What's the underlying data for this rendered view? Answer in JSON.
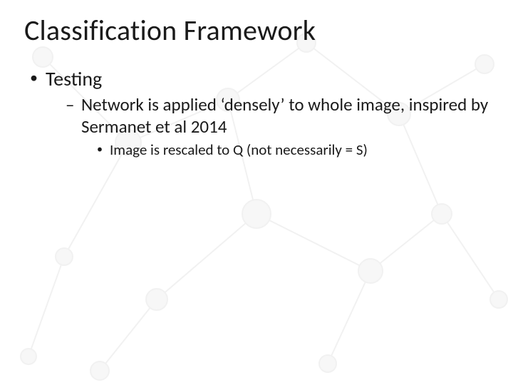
{
  "title": "Classification Framework",
  "bullets": {
    "l1": "Testing",
    "l2": "Network is applied ‘densely’ to whole image, inspired by Sermanet et al 2014",
    "l3": "Image is rescaled to Q (not necessarily = S)"
  }
}
